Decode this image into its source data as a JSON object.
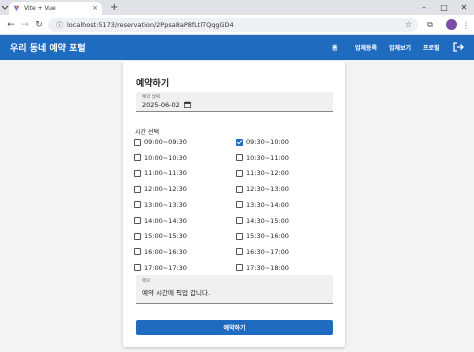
{
  "browser": {
    "tab_title": "Vite + Vue",
    "url": "localhost:5173/reservation/2Ppsa8aP8fLtlTQqgGD4"
  },
  "appbar": {
    "brand": "우리 동네 예약 포털",
    "nav": [
      "홈",
      "업체등록",
      "업체보기",
      "프로필"
    ]
  },
  "form": {
    "title": "예약하기",
    "date_label": "예약 날짜",
    "date_value": "2025-06-02",
    "time_section_label": "시간 선택",
    "slots": [
      {
        "label": "09:00~09:30",
        "checked": false
      },
      {
        "label": "09:30~10:00",
        "checked": true
      },
      {
        "label": "10:00~10:30",
        "checked": false
      },
      {
        "label": "10:30~11:00",
        "checked": false
      },
      {
        "label": "11:00~11:30",
        "checked": false
      },
      {
        "label": "11:30~12:00",
        "checked": false
      },
      {
        "label": "12:00~12:30",
        "checked": false
      },
      {
        "label": "12:30~13:00",
        "checked": false
      },
      {
        "label": "13:00~13:30",
        "checked": false
      },
      {
        "label": "13:30~14:00",
        "checked": false
      },
      {
        "label": "14:00~14:30",
        "checked": false
      },
      {
        "label": "14:30~15:00",
        "checked": false
      },
      {
        "label": "15:00~15:30",
        "checked": false
      },
      {
        "label": "15:30~16:00",
        "checked": false
      },
      {
        "label": "16:00~16:30",
        "checked": false
      },
      {
        "label": "16:30~17:00",
        "checked": false
      },
      {
        "label": "17:00~17:30",
        "checked": false
      },
      {
        "label": "17:30~18:00",
        "checked": false
      }
    ],
    "memo_label": "메모",
    "memo_value": "예약 시간에 픽업 갑니다.",
    "submit_label": "예약하기"
  },
  "colors": {
    "primary": "#1e6bbf",
    "profile": "#7b4ea8"
  }
}
